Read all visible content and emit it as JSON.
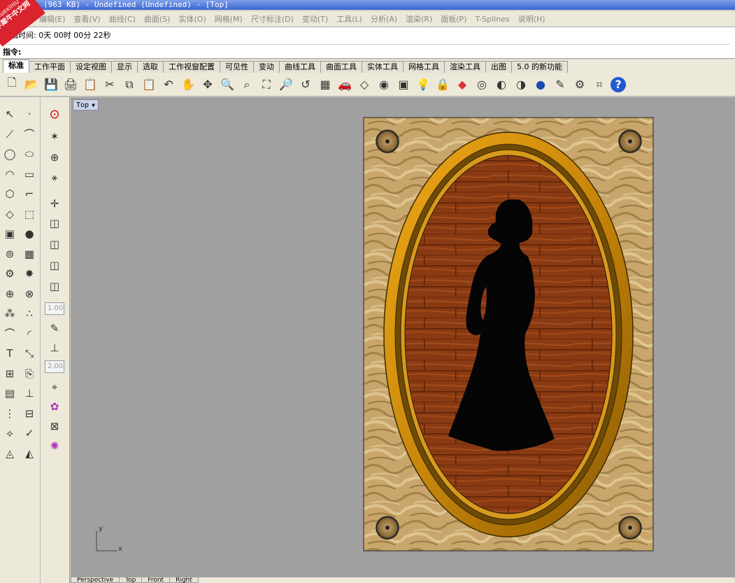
{
  "window": {
    "title": "(963 KB) - Undefined (Undefined) - [Top]"
  },
  "watermark": {
    "line1": "xuexiniu",
    "line2": "学犀牛中文网"
  },
  "menu": [
    "编辑(E)",
    "查看(V)",
    "曲线(C)",
    "曲面(S)",
    "实体(O)",
    "网格(M)",
    "尺寸标注(D)",
    "变动(T)",
    "工具(L)",
    "分析(A)",
    "渲染(R)",
    "面板(P)",
    "T-Splines",
    "说明(H)"
  ],
  "command": {
    "history": "编辑时间: 0天 00时 00分 22秒",
    "prompt": "指令:"
  },
  "tabs": [
    "标准",
    "工作平面",
    "设定视图",
    "显示",
    "选取",
    "工作视窗配置",
    "可见性",
    "变动",
    "曲线工具",
    "曲面工具",
    "实体工具",
    "网格工具",
    "渲染工具",
    "出图",
    "5.0 的新功能"
  ],
  "active_tab": "标准",
  "toolbar_icons": [
    "new-file-icon",
    "open-folder-icon",
    "save-icon",
    "print-icon",
    "import-icon",
    "cut-icon",
    "copy-icon",
    "paste-icon",
    "undo-icon",
    "pan-hand-icon",
    "rotate-view-icon",
    "zoom-dynamic-icon",
    "zoom-window-icon",
    "zoom-extents-icon",
    "zoom-selected-icon",
    "undo-view-icon",
    "four-viewports-icon",
    "car-icon",
    "plane-icon",
    "circle-point-icon",
    "select-grid-icon",
    "light-bulb-icon",
    "lock-icon",
    "layer-icon",
    "color-wheel-icon",
    "shade-icon",
    "render-sphere-icon",
    "blue-sphere-icon",
    "pen-icon",
    "gear-icon",
    "crop-icon",
    "help-icon"
  ],
  "side_fields": {
    "field1": "1.00",
    "field2": "2.00"
  },
  "viewport": {
    "label": "Top",
    "axis_x": "x",
    "axis_y": "y"
  },
  "bottom_tabs": [
    "Perspective",
    "Top",
    "Front",
    "Right"
  ],
  "colors": {
    "frame_gold": "#c8860a",
    "wood": "#8a3a12",
    "fur": "#c9a66b",
    "viewport_bg": "#a0a0a0"
  }
}
